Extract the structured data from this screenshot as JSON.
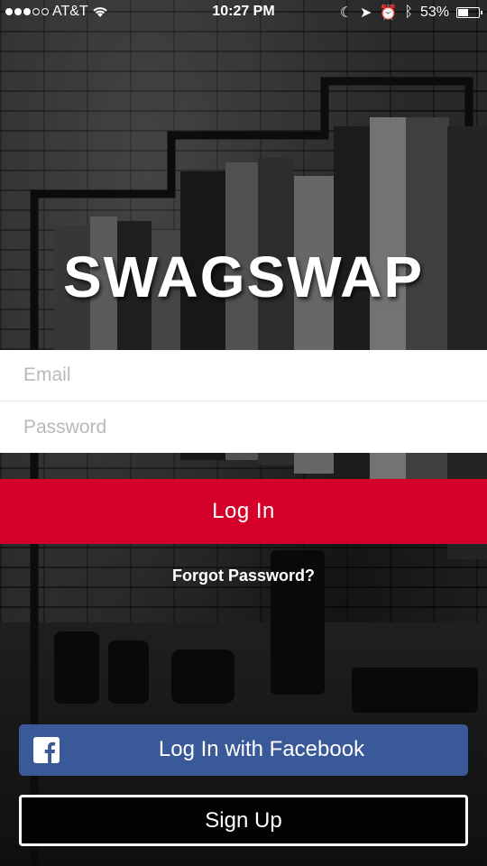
{
  "status_bar": {
    "carrier": "AT&T",
    "time": "10:27 PM",
    "battery": "53%",
    "battery_level": 0.53,
    "signal_bars_filled": 3,
    "signal_bars_total": 5
  },
  "app": {
    "logo": "SWAGSWAP"
  },
  "login_form": {
    "email_placeholder": "Email",
    "password_placeholder": "Password",
    "login_label": "Log In",
    "forgot_password": "Forgot Password?"
  },
  "social": {
    "facebook_label": "Log In with Facebook"
  },
  "signup": {
    "label": "Sign Up"
  },
  "colors": {
    "login_button": "#d4002a",
    "facebook_button": "#3a5999"
  }
}
